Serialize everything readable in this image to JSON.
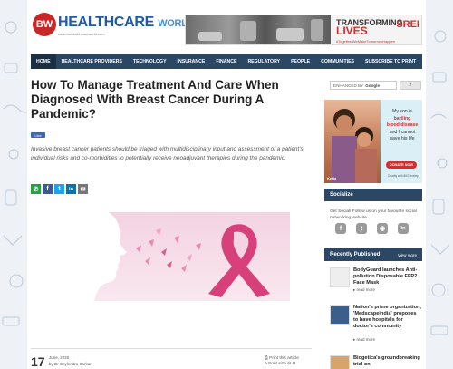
{
  "logo": {
    "bw": "BW",
    "name": "HEALTHCARE",
    "suffix": "WORLD",
    "tagline": "www.bwhealthcareworld.com"
  },
  "banner": {
    "title_line1": "TRANSFORMING",
    "title_line2": "LIVES",
    "hashtag": "#TogetherWeMakeTomorrowHappen",
    "brand": "SREI"
  },
  "nav": {
    "items": [
      "HOME",
      "HEALTHCARE PROVIDERS",
      "TECHNOLOGY",
      "INSURANCE",
      "FINANCE",
      "REGULATORY",
      "PEOPLE",
      "COMMUNITIES",
      "SUBSCRIBE TO PRINT"
    ],
    "active_index": 0
  },
  "article": {
    "title": "How To Manage Treatment And Care When Diagnosed With Breast Cancer During A Pandemic?",
    "like_label": "Like",
    "summary": "Invasive breast cancer patients should be triaged with multidisciplinary input and assessment of a patient's individual risks and co-morbidities to potentially receive neoadjuvant therapies during the pandemic.",
    "share_buttons": [
      {
        "icon": "whatsapp-icon",
        "glyph": "✆",
        "color": "#25a244"
      },
      {
        "icon": "facebook-icon",
        "glyph": "f",
        "color": "#3b5998"
      },
      {
        "icon": "twitter-icon",
        "glyph": "t",
        "color": "#1da1f2"
      },
      {
        "icon": "linkedin-icon",
        "glyph": "in",
        "color": "#0077b5"
      },
      {
        "icon": "email-icon",
        "glyph": "✉",
        "color": "#777777"
      }
    ],
    "date_day": "17",
    "date_month": "June, 2020",
    "author": "by Dr Shylendra Sarkar",
    "print_label": "Print this article",
    "font_size_label": "Font size"
  },
  "sidebar": {
    "search_placeholder": "ENHANCED BY",
    "search_brand": "Google",
    "search_button_icon": "search-icon",
    "ad": {
      "line1": "My son is",
      "line2": "battling",
      "line3": "blood disease",
      "line4": "and I cannot",
      "line5": "save his life",
      "donate": "DONATE NOW",
      "footer": "Charity with 80G exempt",
      "brand": "Ketto"
    },
    "socialize": {
      "heading": "Socialize",
      "text": "Get Social! Follow us on your favourite social networking website.",
      "icons": [
        {
          "name": "facebook-icon",
          "glyph": "f"
        },
        {
          "name": "twitter-icon",
          "glyph": "t"
        },
        {
          "name": "rss-icon",
          "glyph": "◉"
        },
        {
          "name": "linkedin-icon",
          "glyph": "in"
        }
      ]
    },
    "recent": {
      "heading": "Recently Published",
      "view_more": "View more",
      "items": [
        {
          "title": "BodyGuard launches Anti-pollution Disposable FFP2 Face Mask",
          "more": "▸ read more"
        },
        {
          "title": "Nation's prime organization, 'Medscapeindia' proposes to have hospitals for doctor's community",
          "more": "▸ read more"
        },
        {
          "title": "Biogetica's groundbreaking trial on",
          "more": ""
        }
      ]
    }
  }
}
